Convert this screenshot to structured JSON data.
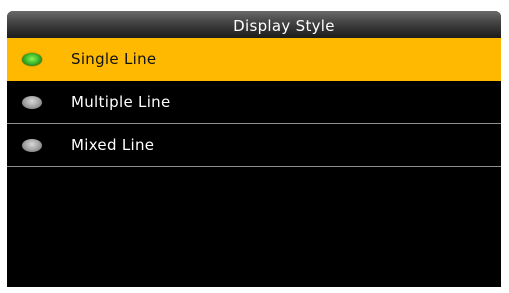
{
  "header": {
    "title": "Display Style"
  },
  "options": [
    {
      "label": "Single Line",
      "selected": true
    },
    {
      "label": "Multiple Line",
      "selected": false
    },
    {
      "label": "Mixed Line",
      "selected": false
    }
  ],
  "colors": {
    "highlight": "#feb900",
    "background": "#000000",
    "radio_on": "#3fbe2a",
    "radio_off": "#a9a9a9"
  },
  "icons": {
    "radio_selected": "radio-selected-icon",
    "radio_unselected": "radio-unselected-icon"
  }
}
